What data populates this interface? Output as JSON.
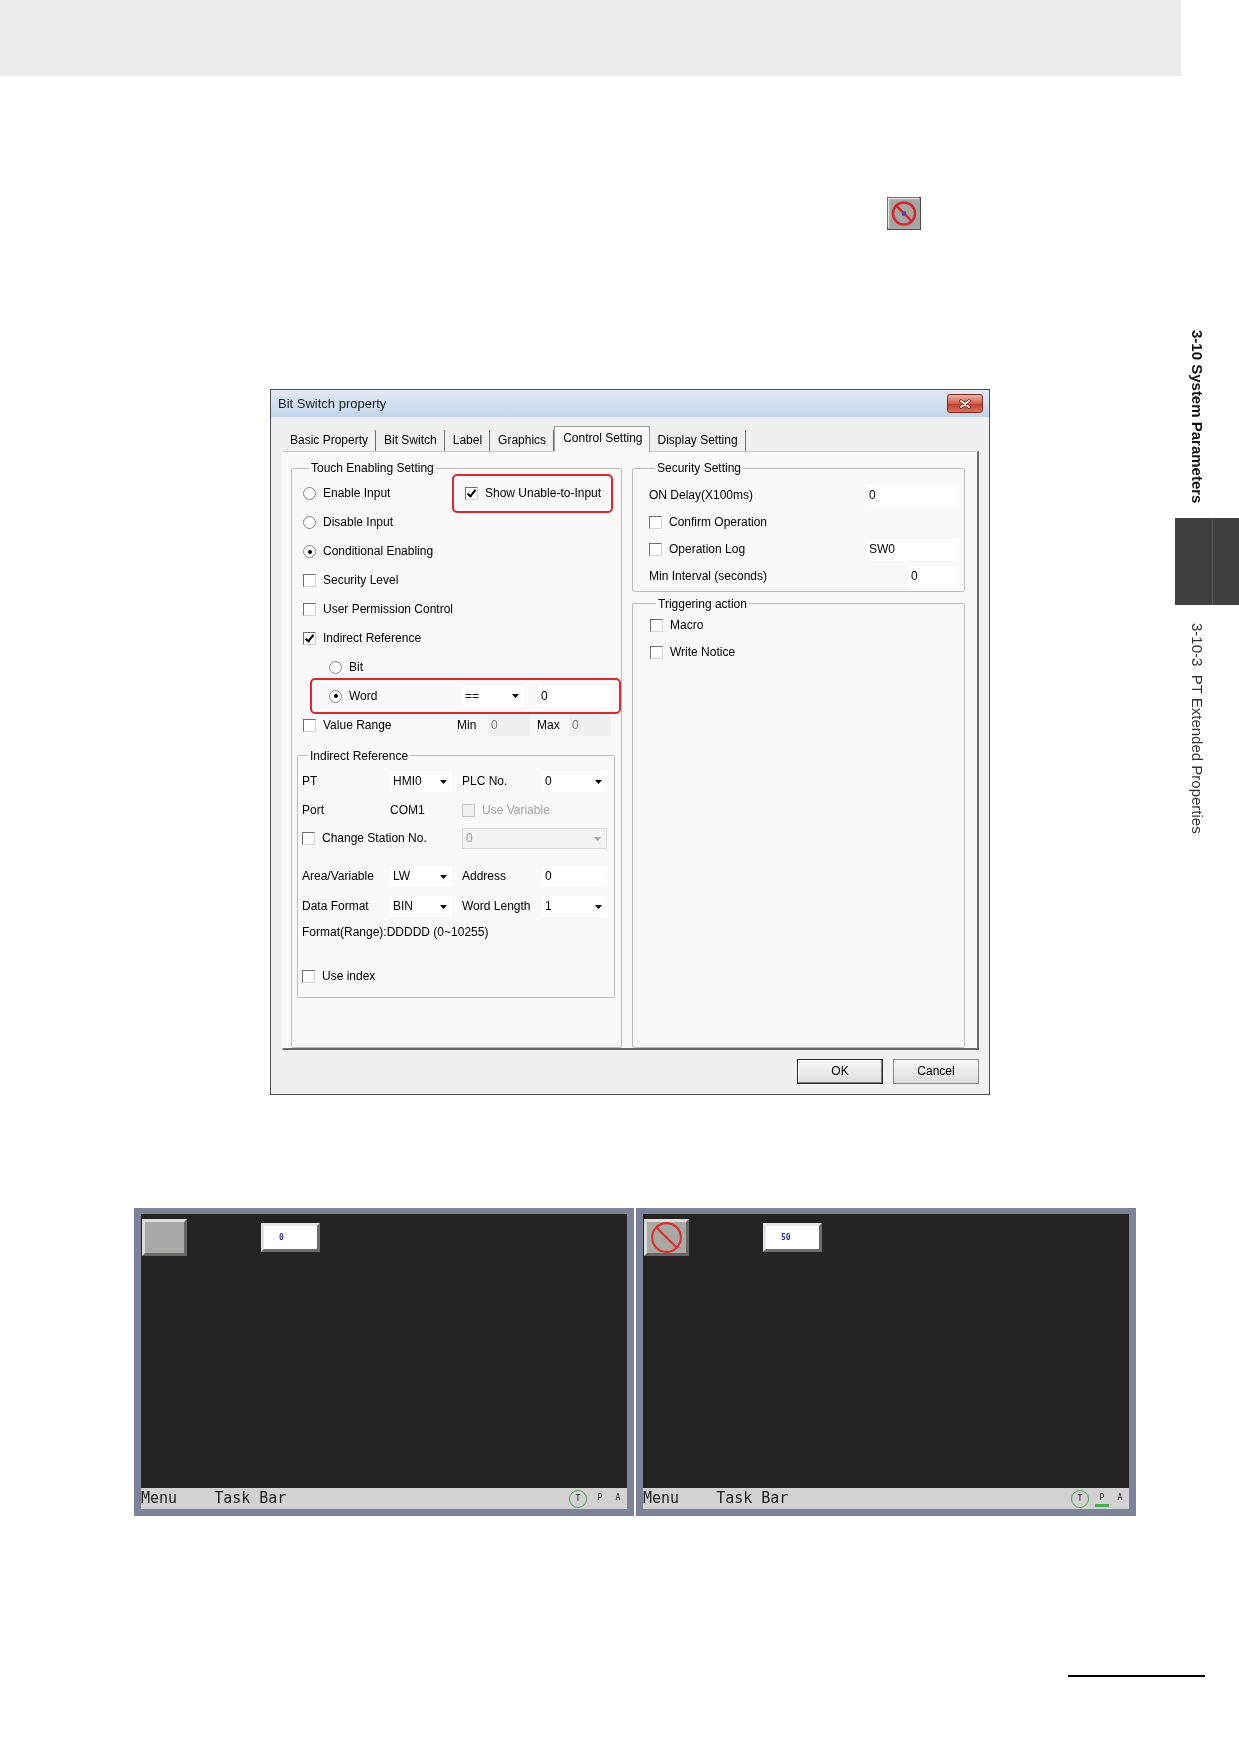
{
  "side_tab": {
    "chapter": "3-10 System Parameters",
    "section": "3-10-3  PT Extended Properties"
  },
  "dialog": {
    "title": "Bit Switch property",
    "tabs": [
      {
        "label": "Basic Property",
        "selected": false
      },
      {
        "label": "Bit Switch",
        "selected": false
      },
      {
        "label": "Label",
        "selected": false
      },
      {
        "label": "Graphics",
        "selected": false
      },
      {
        "label": "Control Setting",
        "selected": true
      },
      {
        "label": "Display Setting",
        "selected": false
      }
    ],
    "touch_enabling": {
      "title": "Touch Enabling Setting",
      "show_unable": {
        "label": "Show Unable-to-Input",
        "checked": true,
        "highlighted": true
      },
      "options": [
        {
          "kind": "radio",
          "label": "Enable Input",
          "selected": false
        },
        {
          "kind": "radio",
          "label": "Disable Input",
          "selected": false
        },
        {
          "kind": "radio",
          "label": "Conditional Enabling",
          "selected": true
        },
        {
          "kind": "checkbox",
          "label": "Security Level",
          "checked": false
        },
        {
          "kind": "checkbox",
          "label": "User Permission Control",
          "checked": false
        },
        {
          "kind": "checkbox",
          "label": "Indirect Reference",
          "checked": true,
          "children": [
            {
              "kind": "radio",
              "label": "Bit",
              "selected": false,
              "highlighted": false
            },
            {
              "kind": "radio",
              "label": "Word",
              "selected": true,
              "highlighted": true,
              "operator": "==",
              "value": "0"
            }
          ]
        },
        {
          "kind": "checkbox",
          "label": "Value Range",
          "checked": false,
          "fields": [
            {
              "label": "Min",
              "value": "0",
              "disabled": true
            },
            {
              "label": "Max",
              "value": "0",
              "disabled": true
            }
          ]
        }
      ],
      "indirect_reference": {
        "title": "Indirect Reference",
        "rows": [
          [
            {
              "kind": "dropdown",
              "label": "PT",
              "value": "HMI0",
              "disabled": false
            },
            {
              "kind": "dropdown",
              "label": "PLC No.",
              "value": "0",
              "disabled": false
            }
          ],
          [
            {
              "kind": "text",
              "label": "Port",
              "value": "COM1"
            },
            {
              "kind": "checkbox",
              "label": "Use Variable",
              "checked": false,
              "disabled": true
            }
          ],
          [
            {
              "kind": "checkbox",
              "label": "Change Station No.",
              "checked": false,
              "disabled": false
            },
            {
              "kind": "dropdown",
              "value": "0",
              "disabled": true
            }
          ],
          [
            {
              "kind": "dropdown",
              "label": "Area/Variable",
              "value": "LW",
              "disabled": false
            },
            {
              "kind": "input",
              "label": "Address",
              "value": "0",
              "disabled": false
            }
          ],
          [
            {
              "kind": "dropdown",
              "label": "Data Format",
              "value": "BIN",
              "disabled": false
            },
            {
              "kind": "dropdown",
              "label": "Word Length",
              "value": "1",
              "disabled": false
            }
          ],
          [
            {
              "kind": "note",
              "text": "Format(Range):DDDDD (0~10255)"
            }
          ],
          [
            {
              "kind": "checkbox",
              "label": "Use index",
              "checked": false,
              "disabled": false
            }
          ]
        ]
      }
    },
    "security": {
      "title": "Security Setting",
      "rows": [
        {
          "kind": "field",
          "label": "ON Delay(X100ms)",
          "value": "0"
        },
        {
          "kind": "checkbox",
          "label": "Confirm Operation",
          "checked": false
        },
        {
          "kind": "checkbox",
          "label": "Operation Log",
          "checked": false,
          "value": "SW0"
        },
        {
          "kind": "field",
          "label": "Min Interval (seconds)",
          "value": "0"
        }
      ]
    },
    "triggering": {
      "title": "Triggering action",
      "options": [
        {
          "label": "Macro",
          "checked": false
        },
        {
          "label": "Write Notice",
          "checked": false
        }
      ]
    },
    "buttons": [
      {
        "label": "OK",
        "default": true
      },
      {
        "label": "Cancel",
        "default": false
      }
    ]
  },
  "screens": [
    {
      "unable_to_input": false,
      "display": "0",
      "taskbar": {
        "menu": "Menu",
        "title": "Task Bar",
        "indicators": [
          {
            "label": "T",
            "kind": "circled",
            "on": false
          },
          {
            "label": "P",
            "kind": "plain",
            "on": false
          },
          {
            "label": "A",
            "kind": "plain",
            "on": false
          }
        ]
      }
    },
    {
      "unable_to_input": true,
      "display": "50",
      "taskbar": {
        "menu": "Menu",
        "title": "Task Bar",
        "indicators": [
          {
            "label": "T",
            "kind": "circled",
            "on": false
          },
          {
            "label": "P",
            "kind": "plain",
            "on": true
          },
          {
            "label": "A",
            "kind": "plain",
            "on": false
          }
        ]
      }
    }
  ]
}
